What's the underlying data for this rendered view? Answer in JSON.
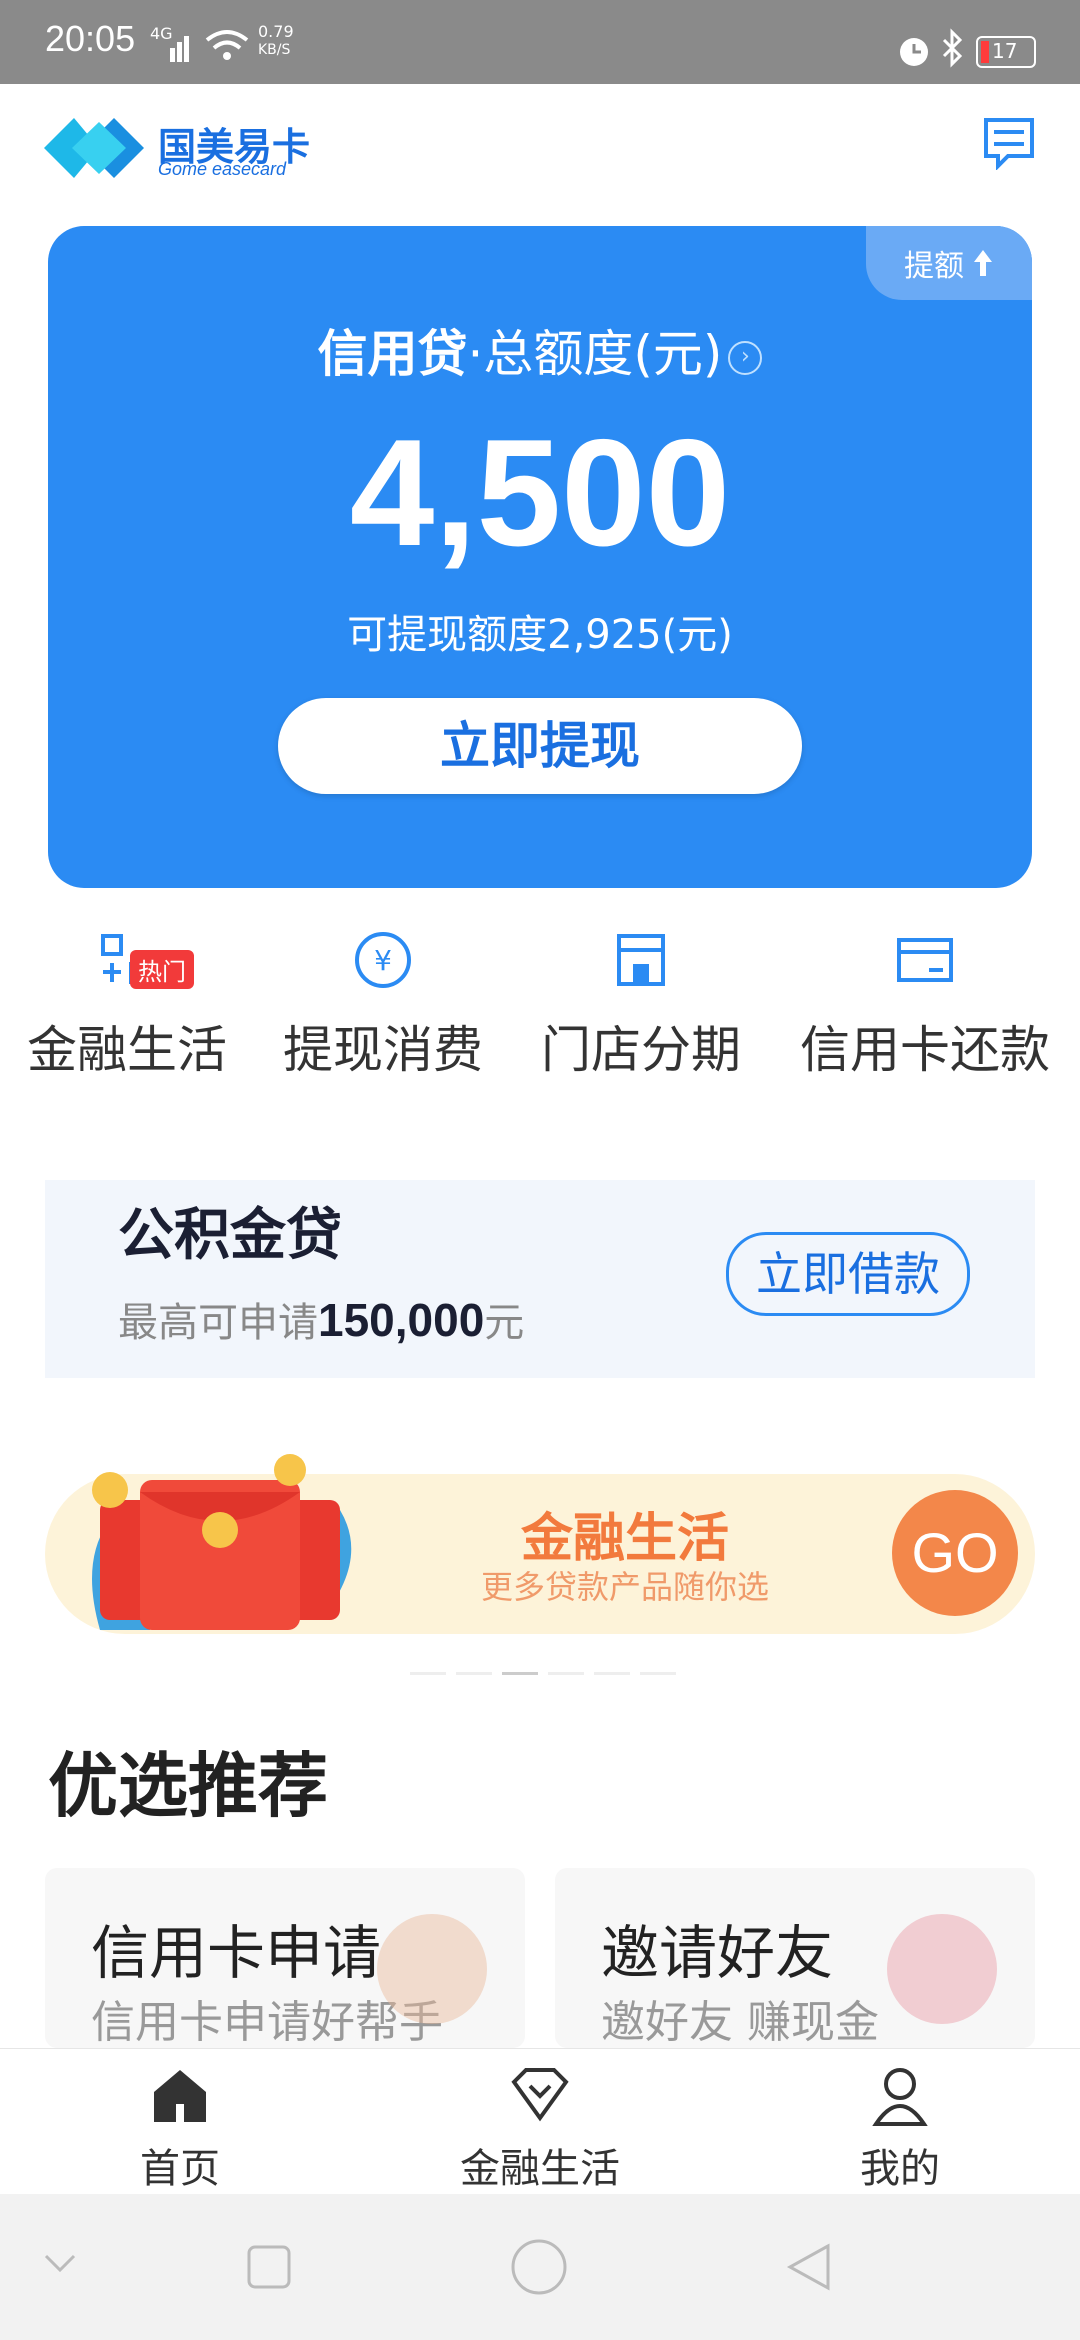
{
  "status_bar": {
    "time": "20:05",
    "signal_label": "4G",
    "net_speed": "0.79",
    "net_speed_unit": "KB/S",
    "battery": "17"
  },
  "header": {
    "logo_cn": "国美易卡",
    "logo_en": "Gome easecard"
  },
  "credit_card": {
    "raise_badge": "提额",
    "title_bold": "信用贷",
    "title_rest": "·总额度(元)",
    "total_amount": "4,500",
    "available_text": "可提现额度2,925(元)",
    "withdraw_button": "立即提现"
  },
  "quick_nav": {
    "hot_badge": "热门",
    "items": [
      {
        "label": "金融生活",
        "icon": "finance-grid-icon"
      },
      {
        "label": "提现消费",
        "icon": "yuan-icon"
      },
      {
        "label": "门店分期",
        "icon": "store-icon"
      },
      {
        "label": "信用卡还款",
        "icon": "card-icon"
      }
    ]
  },
  "loan_banner": {
    "title": "公积金贷",
    "sub_prefix": "最高可申请",
    "sub_amount": "150,000",
    "sub_suffix": "元",
    "button": "立即借款"
  },
  "finance_banner": {
    "title": "金融生活",
    "subtitle": "更多贷款产品随你选",
    "go": "GO"
  },
  "recommend": {
    "title": "优选推荐",
    "cards": [
      {
        "title": "信用卡申请",
        "subtitle": "信用卡申请好帮手"
      },
      {
        "title": "邀请好友",
        "subtitle": "邀好友 赚现金"
      }
    ]
  },
  "tabbar": {
    "tabs": [
      {
        "label": "首页",
        "icon": "home-icon"
      },
      {
        "label": "金融生活",
        "icon": "diamond-icon"
      },
      {
        "label": "我的",
        "icon": "user-icon"
      }
    ]
  },
  "colors": {
    "primary_blue": "#2b8bf3",
    "accent_orange": "#f3874a",
    "hot_red": "#f23a3a"
  }
}
